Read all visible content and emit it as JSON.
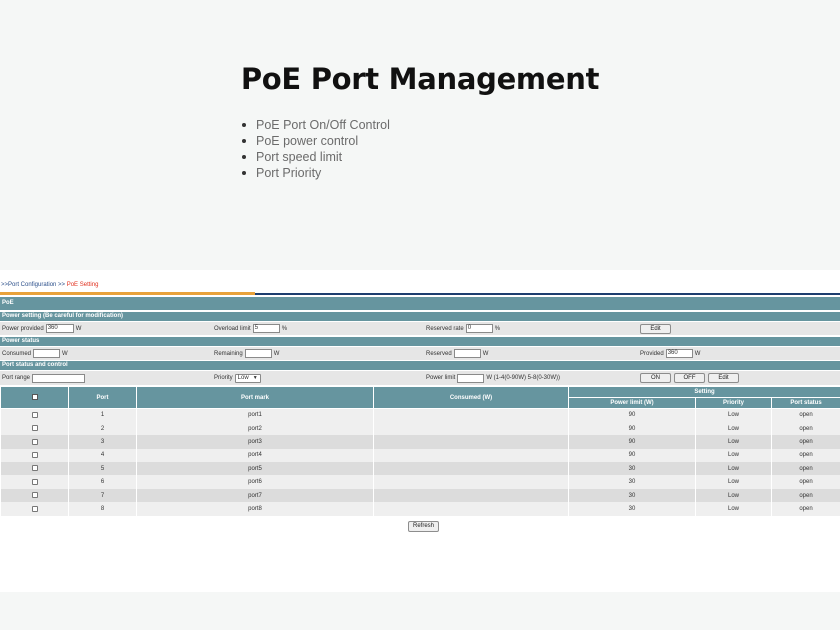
{
  "hero": {
    "title": "PoE Port Management",
    "features": [
      "PoE Port On/Off Control",
      "PoE power control",
      "Port speed limit",
      "Port Priority"
    ]
  },
  "breadcrumb": {
    "part1": ">>Port Configuration >> ",
    "part2": "PoE Setting"
  },
  "sections": {
    "poe": "PoE",
    "power_setting": "Power setting (Be careful for modification)",
    "power_status": "Power status",
    "port_status_control": "Port status and control"
  },
  "power_setting": {
    "provided_label": "Power provided",
    "provided_value": "360",
    "provided_unit": "W",
    "overload_label": "Overload limit",
    "overload_value": "5",
    "overload_unit": "%",
    "reserved_rate_label": "Reserved rate",
    "reserved_rate_value": "0",
    "reserved_rate_unit": "%",
    "edit_label": "Edit"
  },
  "power_status": {
    "consumed_label": "Consumed",
    "consumed_value": "",
    "consumed_unit": "W",
    "remaining_label": "Remaining",
    "remaining_value": "",
    "remaining_unit": "W",
    "reserved_label": "Reserved",
    "reserved_value": "",
    "reserved_unit": "W",
    "provided_label": "Provided",
    "provided_value": "360",
    "provided_unit": "W"
  },
  "control": {
    "port_range_label": "Port range",
    "port_range_value": "",
    "priority_label": "Priority",
    "priority_value": "Low",
    "power_limit_label": "Power limit",
    "power_limit_value": "",
    "power_limit_hint": "W (1-4(0-90W) 5-8(0-30W))",
    "on_label": "ON",
    "off_label": "OFF",
    "edit_label": "Edit"
  },
  "table": {
    "headers": {
      "port": "Port",
      "port_mark": "Port mark",
      "consumed": "Consumed (W)",
      "setting": "Setting",
      "power_limit": "Power limit (W)",
      "priority": "Priority",
      "port_status": "Port status"
    },
    "rows": [
      {
        "port": "1",
        "mark": "port1",
        "consumed": "",
        "limit": "90",
        "priority": "Low",
        "status": "open"
      },
      {
        "port": "2",
        "mark": "port2",
        "consumed": "",
        "limit": "90",
        "priority": "Low",
        "status": "open"
      },
      {
        "port": "3",
        "mark": "port3",
        "consumed": "",
        "limit": "90",
        "priority": "Low",
        "status": "open"
      },
      {
        "port": "4",
        "mark": "port4",
        "consumed": "",
        "limit": "90",
        "priority": "Low",
        "status": "open"
      },
      {
        "port": "5",
        "mark": "port5",
        "consumed": "",
        "limit": "30",
        "priority": "Low",
        "status": "open"
      },
      {
        "port": "6",
        "mark": "port6",
        "consumed": "",
        "limit": "30",
        "priority": "Low",
        "status": "open"
      },
      {
        "port": "7",
        "mark": "port7",
        "consumed": "",
        "limit": "30",
        "priority": "Low",
        "status": "open"
      },
      {
        "port": "8",
        "mark": "port8",
        "consumed": "",
        "limit": "30",
        "priority": "Low",
        "status": "open"
      }
    ]
  },
  "refresh_label": "Refresh",
  "colors": {
    "band": "#66959f",
    "breadcrumb_link": "#2b4f8a",
    "breadcrumb_current": "#e0301e",
    "rule_orange": "#e8a23b",
    "rule_blue": "#1d3d6e"
  }
}
